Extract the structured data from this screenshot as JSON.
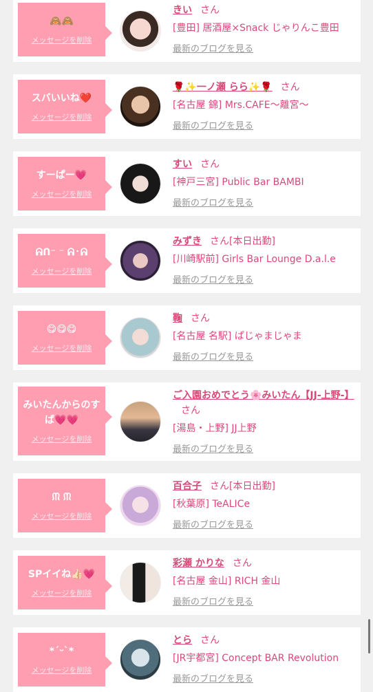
{
  "delete_label": "メッセージを削除",
  "blog_label": "最新のブログを見る",
  "entries": [
    {
      "message": "🙈🙈",
      "name": "きい",
      "suffix": "さん",
      "shop": "[豊田] 居酒屋×Snack じゃりんこ豊田"
    },
    {
      "message": "スバいいね❤️",
      "name": "🌹✨一ノ瀬 らら✨🌹",
      "suffix": "さん",
      "shop": "[名古屋 錦] Mrs.CAFE〜離宮〜"
    },
    {
      "message": "すーぱー💗",
      "name": "すい",
      "suffix": "さん",
      "shop": "[神戸三宮] Public Bar BAMBI"
    },
    {
      "message": "ᕱᑎ⁻ ⁻ ᕱ᛫ᕱ",
      "name": "みずき",
      "suffix": "さん[本日出勤]",
      "shop": "[川崎駅前] Girls Bar Lounge D.a.l.e"
    },
    {
      "message": "😋😋😋",
      "name": "鞠",
      "suffix": "さん",
      "shop": "[名古屋 名駅] ぱじゃまじゃま"
    },
    {
      "message": "みいたんからのすば💗💗",
      "name": "ご入園おめでとう🌸みいたん【JJ-上野-】",
      "suffix": "さん",
      "shop": "[湯島・上野] JJ上野"
    },
    {
      "message": "ᙏ ᙏ",
      "name": "百合子",
      "suffix": "さん[本日出勤]",
      "shop": "[秋葉原] TeALICe"
    },
    {
      "message": "SPイイね👍🏻💗",
      "name": "彩瀬 かりな",
      "suffix": "さん",
      "shop": "[名古屋 金山] RICH 金山"
    },
    {
      "message": "*ˊᵕˋ*",
      "name": "とら",
      "suffix": "さん",
      "shop": "[JR宇都宮] Concept BAR Revolution"
    }
  ]
}
